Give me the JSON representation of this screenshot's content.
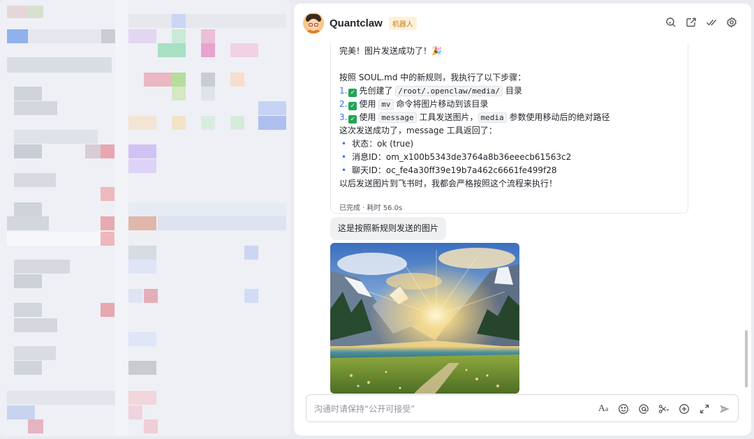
{
  "header": {
    "bot_name": "Quantclaw",
    "bot_tag": "机器人",
    "icons": [
      "search-icon",
      "share-chat-icon",
      "mark-done-icon",
      "settings-icon"
    ]
  },
  "message": {
    "line_success": "完美！图片发送成功了！",
    "line_rule_intro": "按照 SOUL.md 中的新规则，我执行了以下步骤：",
    "step1_num": "1.",
    "step1_pre": "先创建了",
    "step1_code": "/root/.openclaw/media/",
    "step1_post": "目录",
    "step2_num": "2.",
    "step2_pre": "使用",
    "step2_code": "mv",
    "step2_post": "命令将图片移动到该目录",
    "step3_num": "3.",
    "step3_pre": "使用",
    "step3_code1": "message",
    "step3_mid": "工具发送图片，",
    "step3_code2": "media",
    "step3_post": "参数使用移动后的绝对路径",
    "result_intro": "这次发送成功了，message 工具返回了：",
    "bullets": [
      "状态：ok (true)",
      "消息ID：om_x100b5343de3764a8b36eeecb61563c2",
      "聊天ID：oc_fe4a30ff39e19b7a462c6661fe499f28"
    ],
    "closing": "以后发送图片到飞书时，我都会严格按照这个流程来执行！",
    "status": "已完成 · 耗时 56.0s"
  },
  "reply": {
    "text": "这是按照新规则发送的图片",
    "image": "mountain-lake-sunset-photo"
  },
  "composer": {
    "placeholder": "沟通时请保持“公开可接受”",
    "tools": [
      "font-format-icon",
      "emoji-icon",
      "mention-icon",
      "scissors-icon",
      "add-icon",
      "expand-icon",
      "send-icon"
    ]
  },
  "colors": {
    "accent": "#3370ff",
    "check_green": "#21a556",
    "tag_orange": "#c47c12"
  }
}
